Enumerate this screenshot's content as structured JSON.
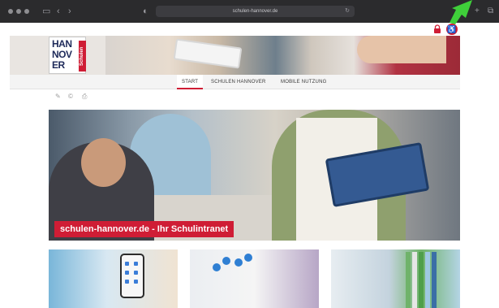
{
  "browser": {
    "url": "schulen-hannover.de",
    "reload_glyph": "↻",
    "back_glyph": "‹",
    "forward_glyph": "›",
    "sidebar_glyph": "▭",
    "shield_glyph": "◐",
    "share_glyph": "⬆",
    "newtab_glyph": "+",
    "tabs_glyph": "⧉"
  },
  "utility": {
    "accessibility_glyph": "♿"
  },
  "logo": {
    "line1": "HAN",
    "line2": "NOV",
    "line3": "ER",
    "tag": "Schulen"
  },
  "nav": {
    "items": [
      {
        "label": "START"
      },
      {
        "label": "SCHULEN HANNOVER"
      },
      {
        "label": "MOBILE NUTZUNG"
      }
    ]
  },
  "tools": {
    "link_glyph": "✎",
    "copy_glyph": "©",
    "print_glyph": "⎙"
  },
  "hero": {
    "caption": "schulen-hannover.de - Ihr Schulintranet"
  },
  "icons": {
    "lock": "lock-icon",
    "accessibility": "accessibility-icon",
    "link": "link-icon",
    "copy": "copy-icon",
    "print": "print-icon"
  },
  "colors": {
    "brand_red": "#cf1d35",
    "brand_navy": "#1e2a5a",
    "arrow_green": "#3fcf3a",
    "chrome_dark": "#2b2b2d"
  }
}
